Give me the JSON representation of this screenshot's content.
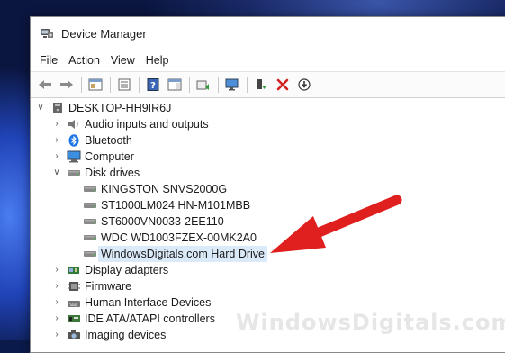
{
  "window": {
    "title": "Device Manager"
  },
  "menu": [
    "File",
    "Action",
    "View",
    "Help"
  ],
  "toolbar": {
    "icons": [
      "back-arrow-icon",
      "forward-arrow-icon",
      "properties-pane-icon",
      "device-list-icon",
      "help-icon",
      "action-pane-icon",
      "update-driver-icon",
      "monitor-scan-icon",
      "enable-device-icon",
      "uninstall-x-icon",
      "download-driver-icon"
    ]
  },
  "tree": {
    "root": "DESKTOP-HH9IR6J",
    "categories": [
      {
        "label": "Audio inputs and outputs",
        "icon": "speaker-icon",
        "expanded": false
      },
      {
        "label": "Bluetooth",
        "icon": "bluetooth-icon",
        "expanded": false
      },
      {
        "label": "Computer",
        "icon": "computer-icon",
        "expanded": false
      },
      {
        "label": "Disk drives",
        "icon": "disk-drive-icon",
        "expanded": true,
        "children": [
          "KINGSTON SNVS2000G",
          "ST1000LM024 HN-M101MBB",
          "ST6000VN0033-2EE110",
          "WDC WD1003FZEX-00MK2A0",
          "WindowsDigitals.com Hard Drive"
        ],
        "selected_child": 4
      },
      {
        "label": "Display adapters",
        "icon": "display-adapter-icon",
        "expanded": false
      },
      {
        "label": "Firmware",
        "icon": "firmware-icon",
        "expanded": false
      },
      {
        "label": "Human Interface Devices",
        "icon": "hid-icon",
        "expanded": false
      },
      {
        "label": "IDE ATA/ATAPI controllers",
        "icon": "ide-controller-icon",
        "expanded": false
      },
      {
        "label": "Imaging devices",
        "icon": "camera-icon",
        "expanded": false
      }
    ]
  },
  "watermark": "WindowsDigitals.com",
  "colors": {
    "arrow": "#e0201f",
    "selection": "#dbeaf9",
    "accent": "#1a73e8"
  }
}
